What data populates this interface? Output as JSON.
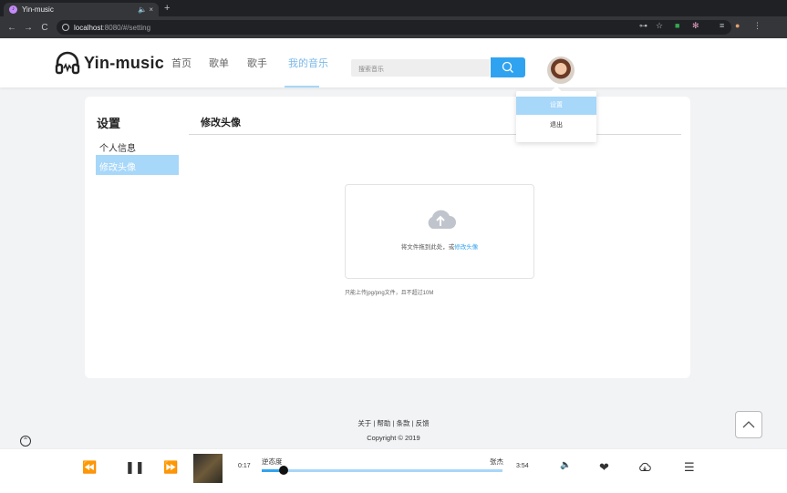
{
  "browser": {
    "tab_title": "Yin-music",
    "tab_controls": "🔈 ×",
    "new_tab": "+",
    "url_host": "localhost",
    "url_path": ":8080/#/setting"
  },
  "header": {
    "brand": "Yin-music",
    "nav": [
      {
        "label": "首页"
      },
      {
        "label": "歌单"
      },
      {
        "label": "歌手"
      },
      {
        "label": "我的音乐",
        "active": true
      }
    ],
    "search_placeholder": "搜索音乐"
  },
  "dropdown": {
    "items": [
      {
        "label": "设置",
        "hover": true
      },
      {
        "label": "退出"
      }
    ]
  },
  "sidebar": {
    "title": "设置",
    "items": [
      {
        "label": "个人信息"
      },
      {
        "label": "修改头像",
        "active": true
      }
    ]
  },
  "main": {
    "section_title": "修改头像",
    "upload_text": "将文件拖到此处，或",
    "upload_link": "修改头像",
    "upload_tip": "只能上传jpg/png文件，且不超过10M"
  },
  "footer": {
    "links": "关于 | 帮助 | 条款 | 反馈",
    "copyright": "Copyright © 2019"
  },
  "player": {
    "current_time": "0:17",
    "total_time": "3:54",
    "song": "逆态度",
    "artist": "张杰",
    "progress": 0.09
  },
  "colors": {
    "accent": "#30a3f0",
    "light_accent": "#a7d7f9"
  }
}
